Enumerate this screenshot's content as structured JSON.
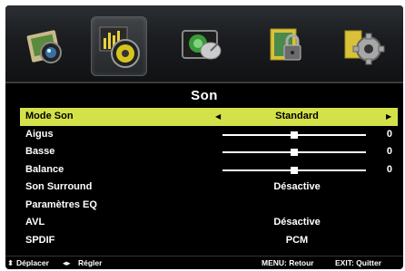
{
  "icons": [
    {
      "name": "picture-icon"
    },
    {
      "name": "sound-icon"
    },
    {
      "name": "channel-icon"
    },
    {
      "name": "lock-icon"
    },
    {
      "name": "setup-icon"
    }
  ],
  "title": "Son",
  "menu": {
    "mode": {
      "label": "Mode Son",
      "value": "Standard"
    },
    "aigus": {
      "label": "Aigus",
      "value": "0",
      "level": 0.5
    },
    "basse": {
      "label": "Basse",
      "value": "0",
      "level": 0.5
    },
    "balance": {
      "label": "Balance",
      "value": "0",
      "level": 0.5
    },
    "surround": {
      "label": "Son Surround",
      "value": "Désactive"
    },
    "eq": {
      "label": "Paramètres EQ"
    },
    "avl": {
      "label": "AVL",
      "value": "Désactive"
    },
    "spdif": {
      "label": "SPDIF",
      "value": "PCM"
    }
  },
  "footer": {
    "move": "Déplacer",
    "adjust": "Régler",
    "menu": "MENU: Retour",
    "exit": "EXIT: Quitter"
  },
  "colors": {
    "highlight": "#d4e24a",
    "background": "#000000"
  }
}
